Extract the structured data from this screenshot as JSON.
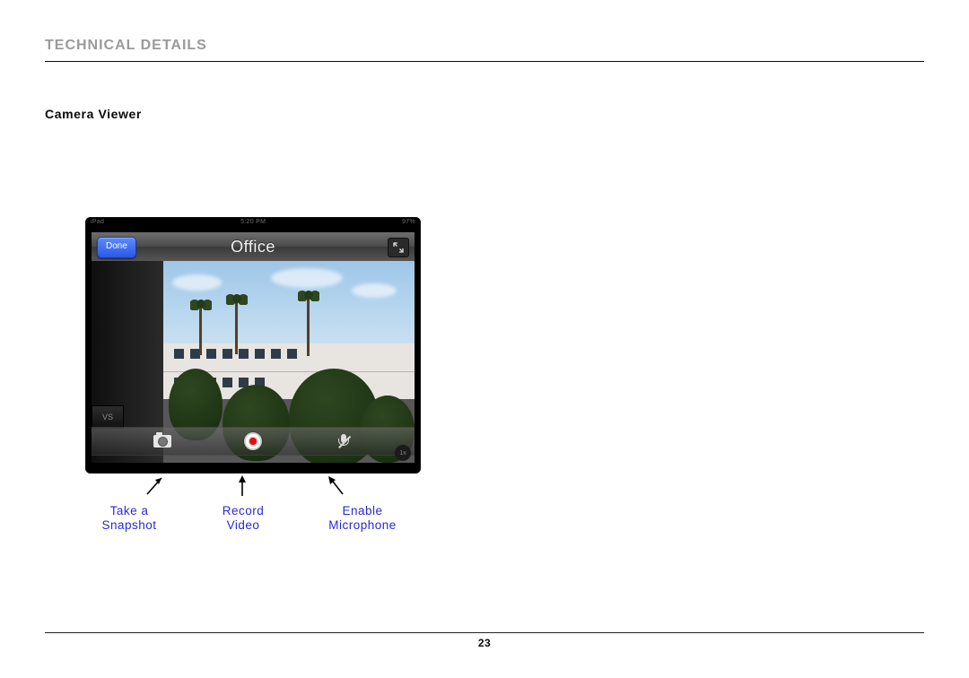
{
  "header": {
    "title": "TECHNICAL DETAILS"
  },
  "section": {
    "subheading": "Camera Viewer"
  },
  "device": {
    "status_left": "iPad",
    "status_time": "5:20 PM",
    "status_right": "97%"
  },
  "viewer": {
    "back_label": "Done",
    "title": "Office",
    "thumb_label": "VS",
    "zoom_label": "1x"
  },
  "annotations": {
    "snapshot": {
      "line1": "Take a",
      "line2": "Snapshot"
    },
    "record": {
      "line1": "Record",
      "line2": "Video"
    },
    "mic": {
      "line1": "Enable",
      "line2": "Microphone"
    }
  },
  "page_number": "23"
}
